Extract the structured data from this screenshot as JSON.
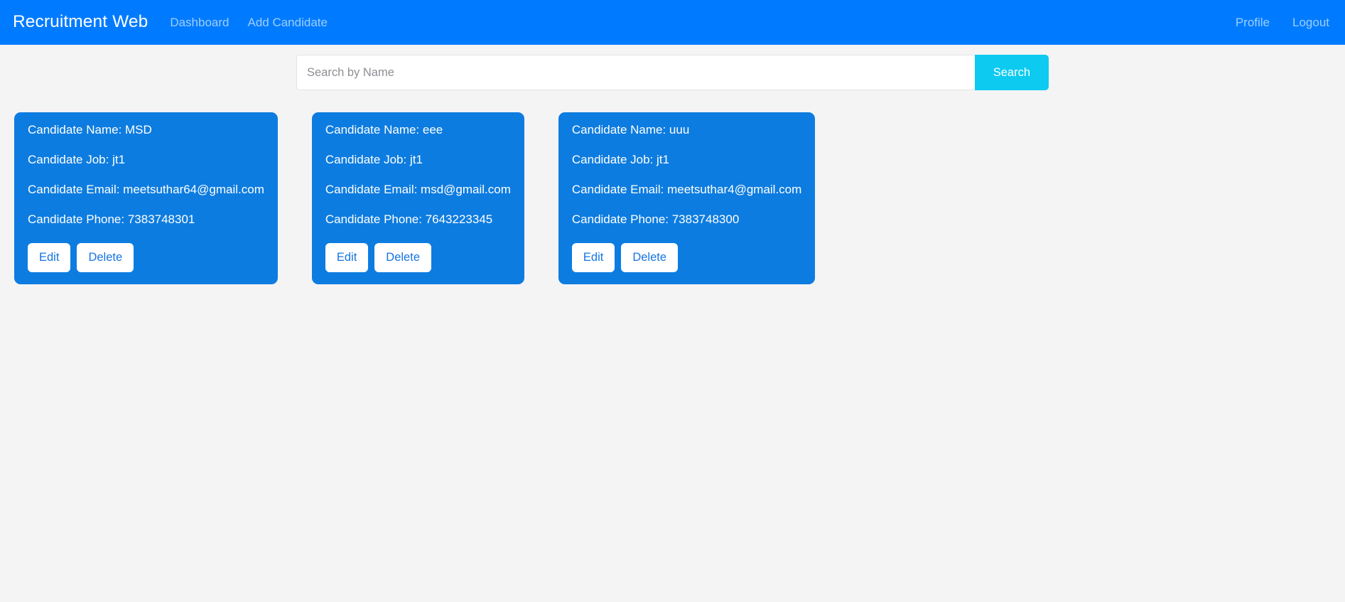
{
  "navbar": {
    "brand": "Recruitment Web",
    "left_links": [
      {
        "label": "Dashboard"
      },
      {
        "label": "Add Candidate"
      }
    ],
    "right_links": [
      {
        "label": "Profile"
      },
      {
        "label": "Logout"
      }
    ],
    "background_color": "#007bff"
  },
  "search": {
    "placeholder": "Search by Name",
    "value": "",
    "button_label": "Search",
    "button_color": "#0dcaf0"
  },
  "cards": {
    "labels": {
      "name": "Candidate Name:",
      "job": "Candidate Job:",
      "email": "Candidate Email:",
      "phone": "Candidate Phone:",
      "edit": "Edit",
      "delete": "Delete"
    },
    "background_color": "#0d7ce0",
    "button_text_color": "#1474e4",
    "items": [
      {
        "name_line": "Candidate Name: MSD",
        "job_line": "Candidate Job: jt1",
        "email_line": "Candidate Email: meetsuthar64@gmail.com",
        "phone_line": "Candidate Phone: 7383748301",
        "edit_label": "Edit",
        "delete_label": "Delete"
      },
      {
        "name_line": "Candidate Name: eee",
        "job_line": "Candidate Job: jt1",
        "email_line": "Candidate Email: msd@gmail.com",
        "phone_line": "Candidate Phone: 7643223345",
        "edit_label": "Edit",
        "delete_label": "Delete"
      },
      {
        "name_line": "Candidate Name: uuu",
        "job_line": "Candidate Job: jt1",
        "email_line": "Candidate Email: meetsuthar4@gmail.com",
        "phone_line": "Candidate Phone: 7383748300",
        "edit_label": "Edit",
        "delete_label": "Delete"
      }
    ]
  },
  "page": {
    "background_color": "#f4f4f5"
  }
}
